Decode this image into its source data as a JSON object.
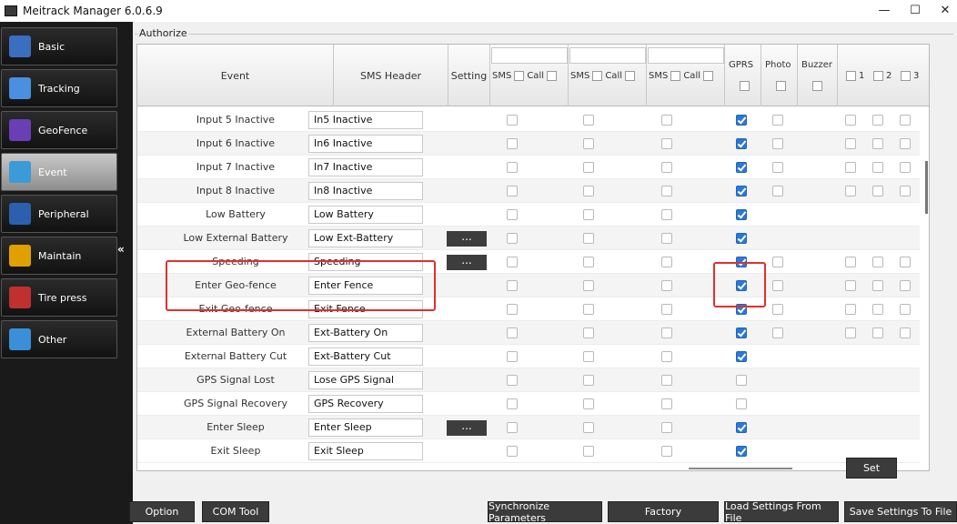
{
  "window": {
    "title": "Meitrack Manager 6.0.6.9",
    "minimize": "—",
    "maximize": "☐",
    "close": "✕"
  },
  "sidebar": {
    "collapse_label": "«",
    "items": [
      {
        "label": "Basic",
        "icon": "basic-icon",
        "color": "#3a6fbf"
      },
      {
        "label": "Tracking",
        "icon": "tracking-icon",
        "color": "#4a8fe0"
      },
      {
        "label": "GeoFence",
        "icon": "geofence-icon",
        "color": "#6a3fb5"
      },
      {
        "label": "Event",
        "icon": "event-icon",
        "color": "#3b9bd6"
      },
      {
        "label": "Peripheral",
        "icon": "peripheral-icon",
        "color": "#2d5fb0"
      },
      {
        "label": "Maintain",
        "icon": "maintain-icon",
        "color": "#e0a000"
      },
      {
        "label": "Tire press",
        "icon": "tire-press-icon",
        "color": "#c03030"
      },
      {
        "label": "Other",
        "icon": "other-icon",
        "color": "#3a8fd8"
      }
    ]
  },
  "authorize": {
    "title": "Authorize",
    "headers": {
      "event": "Event",
      "sms_header": "SMS Header",
      "setting": "Setting",
      "sms": "SMS",
      "call": "Call",
      "gprs": "GPRS",
      "photo": "Photo",
      "buzzer": "Buzzer",
      "out1": "1",
      "out2": "2",
      "out3": "3"
    },
    "rows": [
      {
        "event": "Input 5 Inactive",
        "sms": "In5 Inactive",
        "setting": false,
        "gprs": true,
        "photo": true,
        "outputs": true
      },
      {
        "event": "Input 6 Inactive",
        "sms": "In6 Inactive",
        "setting": false,
        "gprs": true,
        "photo": true,
        "outputs": true
      },
      {
        "event": "Input 7 Inactive",
        "sms": "In7 Inactive",
        "setting": false,
        "gprs": true,
        "photo": true,
        "outputs": true
      },
      {
        "event": "Input 8 Inactive",
        "sms": "In8 Inactive",
        "setting": false,
        "gprs": true,
        "photo": true,
        "outputs": true
      },
      {
        "event": "Low Battery",
        "sms": "Low Battery",
        "setting": false,
        "gprs": true,
        "photo": false,
        "outputs": false
      },
      {
        "event": "Low External Battery",
        "sms": "Low Ext-Battery",
        "setting": true,
        "gprs": true,
        "photo": false,
        "outputs": false
      },
      {
        "event": "Speeding",
        "sms": "Speeding",
        "setting": true,
        "gprs": true,
        "photo": true,
        "outputs": true
      },
      {
        "event": "Enter Geo-fence",
        "sms": "Enter Fence",
        "setting": false,
        "gprs": true,
        "photo": true,
        "outputs": true
      },
      {
        "event": "Exit Geo-fence",
        "sms": "Exit Fence",
        "setting": false,
        "gprs": true,
        "photo": true,
        "outputs": true
      },
      {
        "event": "External Battery On",
        "sms": "Ext-Battery On",
        "setting": false,
        "gprs": true,
        "photo": true,
        "outputs": true
      },
      {
        "event": "External Battery Cut",
        "sms": "Ext-Battery Cut",
        "setting": false,
        "gprs": true,
        "photo": false,
        "outputs": false
      },
      {
        "event": "GPS Signal Lost",
        "sms": "Lose GPS Signal",
        "setting": false,
        "gprs": false,
        "photo": false,
        "outputs": false
      },
      {
        "event": "GPS Signal Recovery",
        "sms": "GPS Recovery",
        "setting": false,
        "gprs": false,
        "photo": false,
        "outputs": false
      },
      {
        "event": "Enter Sleep",
        "sms": "Enter Sleep",
        "setting": true,
        "gprs": true,
        "photo": false,
        "outputs": false
      },
      {
        "event": "Exit Sleep",
        "sms": "Exit Sleep",
        "setting": false,
        "gprs": true,
        "photo": false,
        "outputs": false
      }
    ],
    "setting_button": "...",
    "set_button": "Set"
  },
  "footer": {
    "option": "Option",
    "com_tool": "COM Tool",
    "sync": "Synchronize Parameters",
    "factory": "Factory",
    "load": "Load Settings From File",
    "save": "Save Settings To File"
  },
  "colors": {
    "checked": "#2979d9",
    "highlight": "#e0302e",
    "sidebar_bg": "#1a1a1a"
  }
}
